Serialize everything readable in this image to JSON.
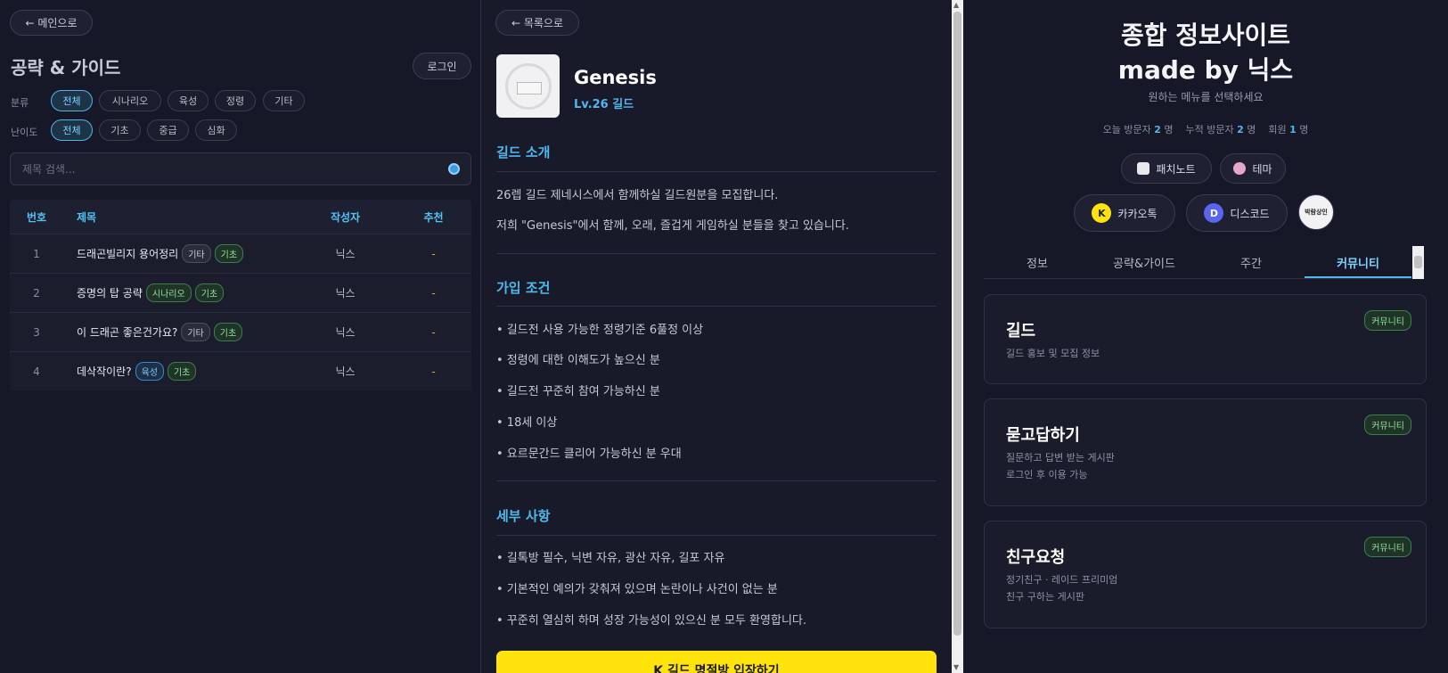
{
  "left": {
    "back_label": "← 메인으로",
    "title": "공략 & 가이드",
    "login_label": "로그인",
    "category_label": "분류",
    "categories": [
      "전체",
      "시나리오",
      "육성",
      "정령",
      "기타"
    ],
    "difficulty_label": "난이도",
    "difficulties": [
      "전체",
      "기초",
      "중급",
      "심화"
    ],
    "search_placeholder": "제목 검색...",
    "table": {
      "headers": {
        "no": "번호",
        "title": "제목",
        "author": "작성자",
        "rec": "추천"
      },
      "rows": [
        {
          "no": "1",
          "title": "드래곤빌리지 용어정리",
          "tags": [
            "기타",
            "기초"
          ],
          "author": "닉스",
          "rec": "-"
        },
        {
          "no": "2",
          "title": "증명의 탑 공략",
          "tags": [
            "시나리오",
            "기초"
          ],
          "author": "닉스",
          "rec": "-"
        },
        {
          "no": "3",
          "title": "이 드래곤 좋은건가요?",
          "tags": [
            "기타",
            "기초"
          ],
          "author": "닉스",
          "rec": "-"
        },
        {
          "no": "4",
          "title": "데삭작이란?",
          "tags": [
            "육성",
            "기초"
          ],
          "author": "닉스",
          "rec": "-"
        }
      ]
    }
  },
  "mid": {
    "back_label": "← 목록으로",
    "guild_name": "Genesis",
    "guild_level": "Lv.26 길드",
    "intro_heading": "길드 소개",
    "intro": [
      "26렙 길드 제네시스에서 함께하실 길드원분을 모집합니다.",
      "저희 \"Genesis\"에서 함께, 오래, 즐겁게 게임하실 분들을 찾고 있습니다."
    ],
    "req_heading": "가입 조건",
    "requirements": [
      "• 길드전 사용 가능한 정령기준 6풀정 이상",
      "• 정령에 대한 이해도가 높으신 분",
      "• 길드전 꾸준히 참여 가능하신 분",
      "• 18세 이상",
      "• 요르문간드 클리어 가능하신 분 우대"
    ],
    "detail_heading": "세부 사항",
    "details": [
      "• 길톡방 필수, 닉변 자유, 광산 자유, 길포 자유",
      "• 기본적인 예의가 갖춰져 있으며 논란이나 사건이 없는 분",
      "• 꾸준히 열심히 하며 성장 가능성이 있으신 분 모두 환영합니다."
    ],
    "join_button": "K  길드 명절방 입장하기"
  },
  "right": {
    "title_line1": "종합 정보사이트",
    "title_line2": "made by 닉스",
    "subtitle": "원하는 메뉴를 선택하세요",
    "stats": {
      "today_label": "오늘 방문자",
      "today": "2",
      "today_unit": "명",
      "total_label": "누적 방문자",
      "total": "2",
      "total_unit": "명",
      "member_label": "회원",
      "member": "1",
      "member_unit": "명"
    },
    "patchnote_label": "패치노트",
    "theme_label": "테마",
    "kakao_label": "카카오톡",
    "kakao_icon": "K",
    "discord_label": "디스코드",
    "discord_icon": "D",
    "avatar_text": "박람상인",
    "tabs": [
      "정보",
      "공략&가이드",
      "주간",
      "커뮤니티"
    ],
    "cards": [
      {
        "title": "길드",
        "desc1": "길드 홍보 및 모집 정보",
        "desc2": "",
        "badge": "커뮤니티"
      },
      {
        "title": "묻고답하기",
        "desc1": "질문하고 답변 받는 게시판",
        "desc2": "로그인 후 이용 가능",
        "badge": "커뮤니티"
      },
      {
        "title": "친구요청",
        "desc1": "정기친구 · 레이드 프리미엄",
        "desc2": "친구 구하는 게시판",
        "badge": "커뮤니티"
      }
    ],
    "colors": {
      "accent": "#4fb8ee",
      "kakao": "#ffe30a",
      "discord": "#5865f2"
    }
  }
}
